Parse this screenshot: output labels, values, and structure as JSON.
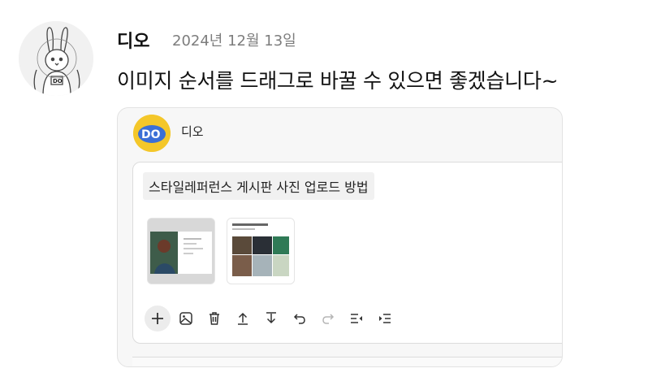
{
  "comment": {
    "author": "디오",
    "date": "2024년 12월 13일",
    "text": "이미지 순서를 드래그로 바꿀 수 있으면 좋겠습니다~"
  },
  "embed": {
    "author": "디오",
    "editor_title": "스타일레퍼런스 게시판 사진 업로드 방법"
  },
  "toolbar": {
    "icons": [
      "plus-icon",
      "image-icon",
      "trash-icon",
      "move-up-icon",
      "move-down-icon",
      "undo-icon",
      "redo-icon",
      "outdent-icon",
      "indent-icon"
    ]
  },
  "colors": {
    "text": "#111111",
    "muted": "#7d7d7d",
    "card_bg": "#f7f7f7",
    "border": "#e2e2e2",
    "avatar_yellow": "#f4c72a"
  }
}
